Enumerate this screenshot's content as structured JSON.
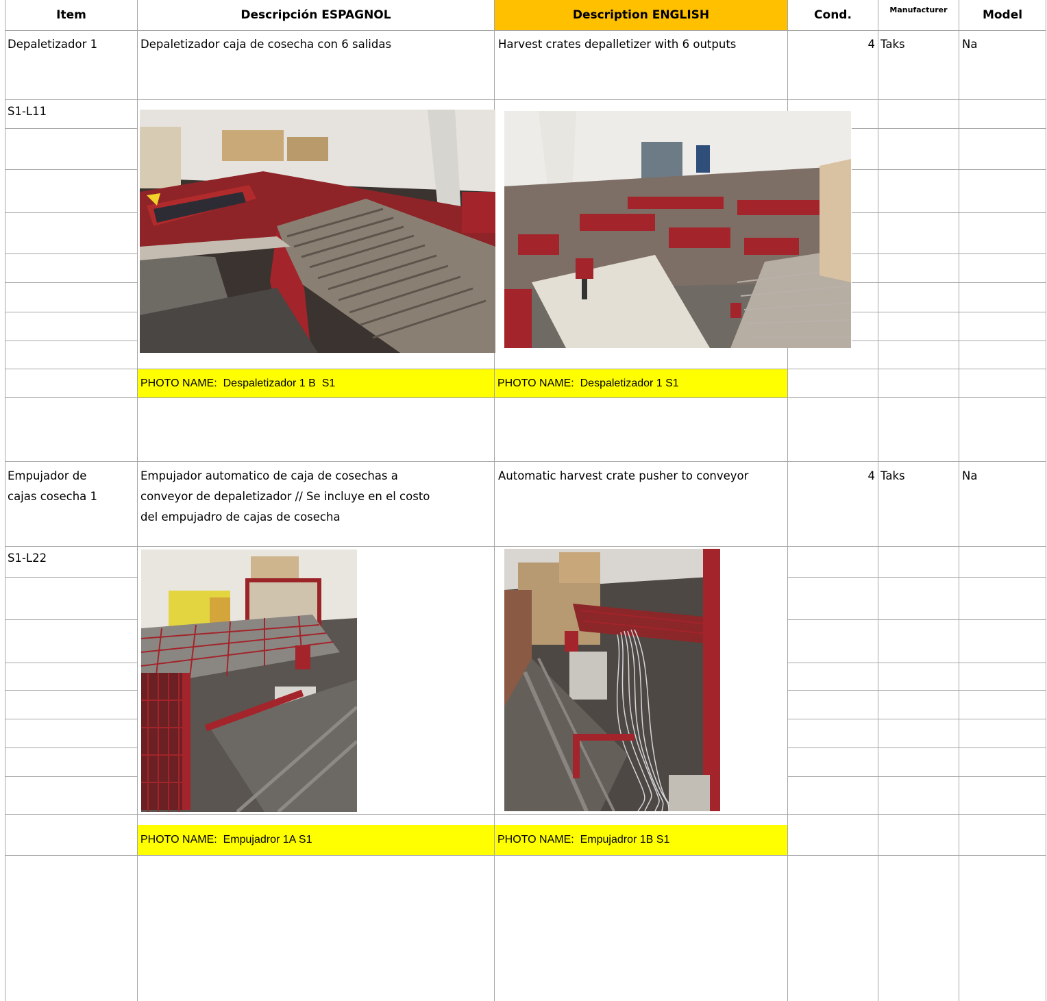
{
  "headers": {
    "item": "Item",
    "desc_es": "Descripción ESPAGNOL",
    "desc_en": "Description ENGLISH",
    "cond": "Cond.",
    "manufacturer": "Manufacturer",
    "model": "Model"
  },
  "rows": [
    {
      "item": "Depaletizador 1",
      "desc_es": [
        "Depaletizador caja de cosecha con 6 salidas"
      ],
      "desc_en": "Harvest crates depalletizer with 6 outputs",
      "cond": "4",
      "manufacturer": "Taks",
      "model": "Na",
      "code": "S1-L11",
      "photo_caption_es": "PHOTO NAME:  Despaletizador 1 B  S1",
      "photo_caption_en": "PHOTO NAME:  Despaletizador 1 S1"
    },
    {
      "item": [
        "Empujador de",
        "cajas cosecha 1"
      ],
      "desc_es": [
        "Empujador automatico de caja de cosechas a",
        "conveyor de depaletizador // Se incluye en el costo",
        "del empujadro de cajas de cosecha"
      ],
      "desc_en": "Automatic harvest crate pusher to conveyor",
      "cond": "4",
      "manufacturer": "Taks",
      "model": "Na",
      "code": "S1-L22",
      "photo_caption_es": "PHOTO NAME:  Empujadror 1A S1",
      "photo_caption_en": "PHOTO NAME:  Empujadror 1B S1"
    }
  ],
  "colors": {
    "english_header": "#ffc000",
    "photo_caption": "#ffff00",
    "grid": "#a6a6a6",
    "machine_red": "#a3242a"
  }
}
